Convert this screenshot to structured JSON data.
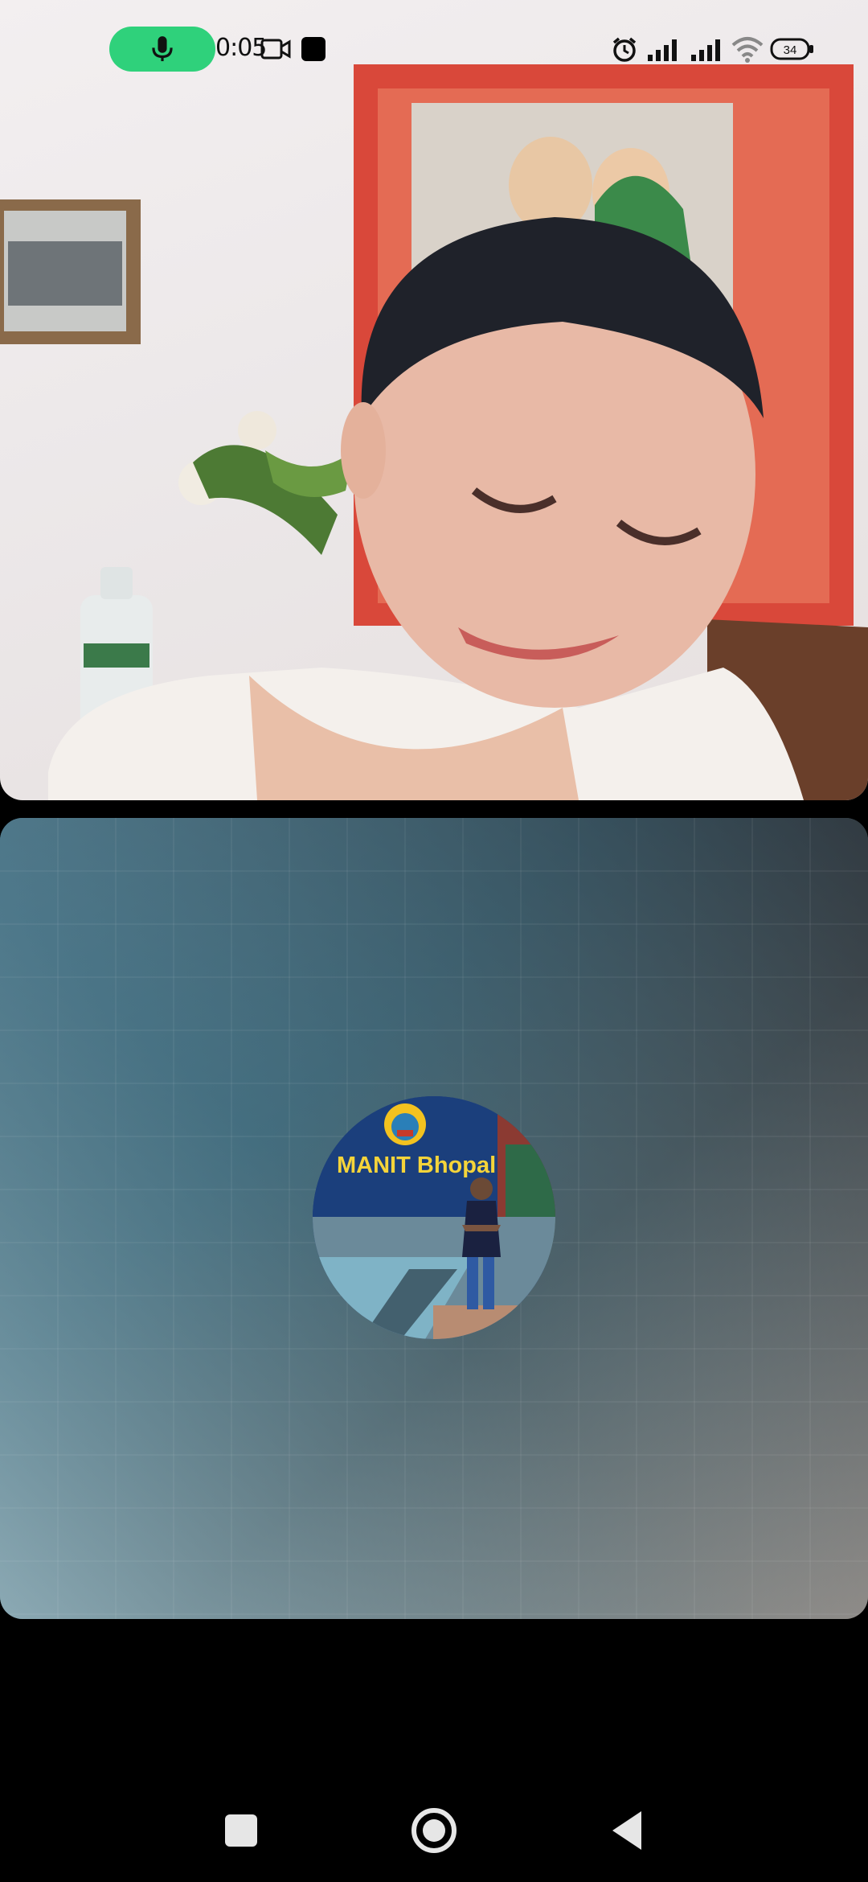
{
  "status_bar": {
    "call_duration": "0:05",
    "battery_level": "34",
    "icons": [
      "microphone-icon",
      "video-camera-icon",
      "stop-square-icon",
      "alarm-icon",
      "signal-icon",
      "signal-icon",
      "wifi-icon",
      "battery-icon"
    ]
  },
  "remote_video": {
    "description_icons": [
      "framed-picture",
      "framed-painting",
      "flower-vase",
      "water-bottle"
    ]
  },
  "local_video": {
    "avatar_caption": "MANIT Bhopal"
  },
  "navigation": {
    "buttons": [
      "recents-square-icon",
      "home-circle-icon",
      "back-triangle-icon"
    ]
  },
  "colors": {
    "call_pill": "#2fd17b",
    "background": "#000000",
    "local_tile_accent": "#2b566c"
  }
}
